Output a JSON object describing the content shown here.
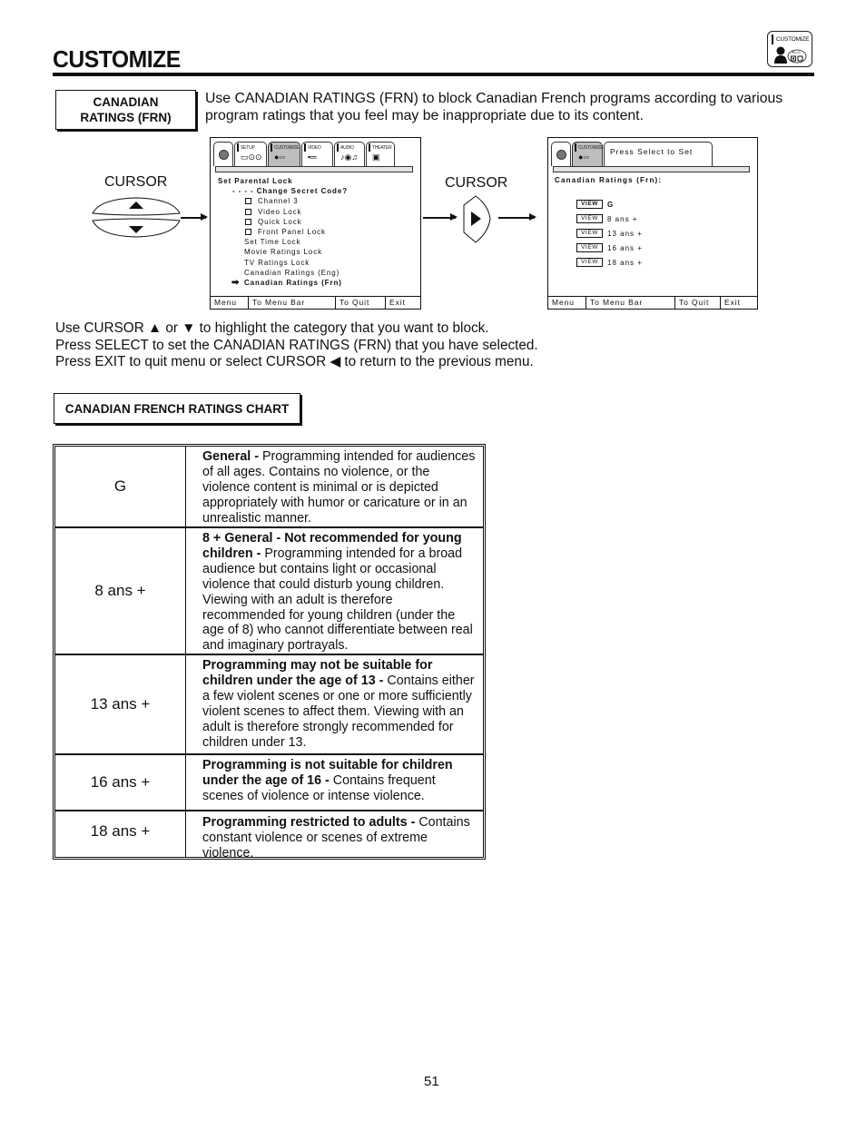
{
  "header": {
    "title": "CUSTOMIZE",
    "corner_icon": {
      "label": "CUSTOMIZE",
      "icon": "customize-person-icon"
    }
  },
  "section_label": "CANADIAN RATINGS (FRN)",
  "intro_text": "Use CANADIAN RATINGS (FRN) to block Canadian French programs according to various program ratings that you feel may be inappropriate due to its content.",
  "cursor_labels": {
    "first": "CURSOR",
    "second": "CURSOR"
  },
  "screen1": {
    "tabs": [
      {
        "label": "",
        "icon": "navigation-knob-icon"
      },
      {
        "label": "SETUP",
        "icon": "setup-icon"
      },
      {
        "label": "CUSTOMIZE",
        "icon": "customize-icon",
        "active": true
      },
      {
        "label": "VIDEO",
        "icon": "video-sliders-icon"
      },
      {
        "label": "AUDIO",
        "icon": "audio-icon"
      },
      {
        "label": "THEATER",
        "icon": "theater-icon"
      }
    ],
    "menu": {
      "heading": "Set Parental Lock",
      "change_code": "- - - - Change Secret Code?",
      "checkbox_items": [
        "Channel 3",
        "Video Lock",
        "Quick Lock",
        "Front Panel Lock"
      ],
      "items": [
        "Set Time Lock",
        "Movie Ratings Lock",
        "TV Ratings Lock",
        "Canadian Ratings (Eng)"
      ],
      "selected": "Canadian Ratings (Frn)"
    },
    "footer": [
      "Menu",
      "To Menu Bar",
      "To Quit",
      "Exit"
    ]
  },
  "screen2": {
    "tab_label": "CUSTOMIZE",
    "prompt": "Press Select to Set",
    "heading": "Canadian Ratings (Frn):",
    "view_label": "VIEW",
    "ratings": [
      {
        "value": "G",
        "highlighted": true
      },
      {
        "value": "8 ans +",
        "highlighted": false
      },
      {
        "value": "13 ans +",
        "highlighted": false
      },
      {
        "value": "16 ans +",
        "highlighted": false
      },
      {
        "value": "18 ans +",
        "highlighted": false
      }
    ],
    "footer": [
      "Menu",
      "To Menu Bar",
      "To Quit",
      "Exit"
    ]
  },
  "instructions": [
    "Use CURSOR ▲ or ▼ to highlight the category that you want to block.",
    "Press SELECT to set the CANADIAN RATINGS (FRN) that you have selected.",
    "Press EXIT to quit menu or select CURSOR ◀  to return to the previous menu."
  ],
  "chart_label": "CANADIAN FRENCH RATINGS CHART",
  "ratings_table": [
    {
      "rating": "G",
      "bold": "General -",
      "text": " Programming intended for audiences of all ages.  Contains no violence, or the violence content is minimal or is depicted appropriately with humor or caricature or in an unrealistic manner."
    },
    {
      "rating": "8 ans +",
      "bold": "8 + General - Not recommended for young children -",
      "text": "  Programming intended for a broad audience but contains light or occasional violence that could disturb young children. Viewing with an adult is therefore recommended for young children (under the age of 8) who cannot differentiate between real and imaginary portrayals."
    },
    {
      "rating": "13 ans +",
      "bold": "Programming may not be suitable for children under the age of 13 -",
      "text": " Contains either a few violent scenes or one or more sufficiently violent scenes to affect them.  Viewing with an adult is therefore strongly recommended for children under 13."
    },
    {
      "rating": "16 ans +",
      "bold": "Programming is not suitable for children under the age of 16 -",
      "text": " Contains frequent scenes of violence or intense violence."
    },
    {
      "rating": "18 ans +",
      "bold": "Programming restricted to adults -",
      "text": "  Contains constant violence or scenes of extreme violence."
    }
  ],
  "page_number": "51"
}
